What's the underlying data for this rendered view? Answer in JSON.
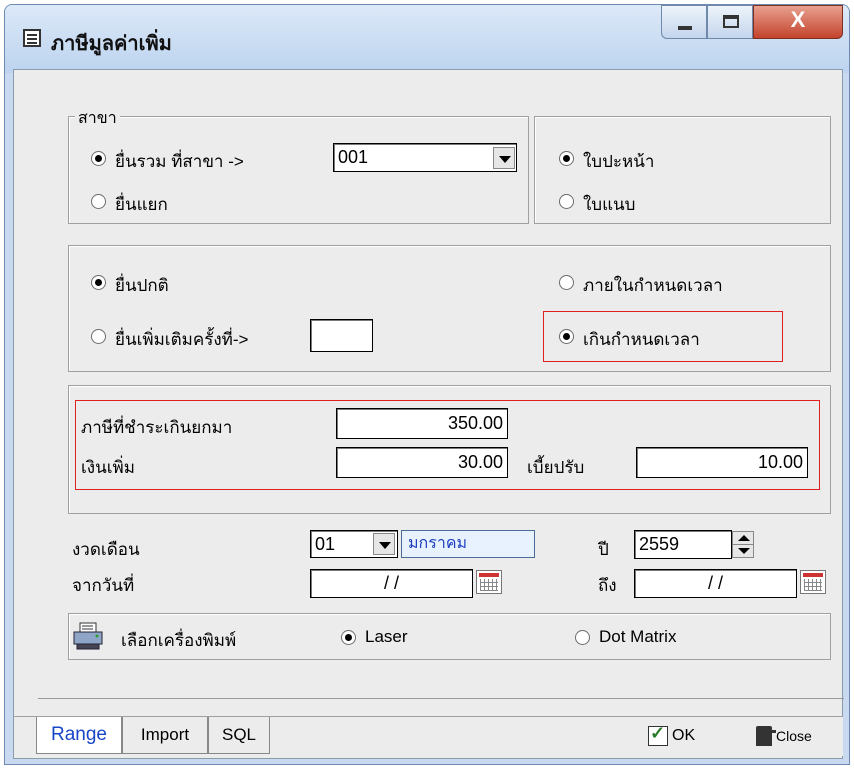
{
  "window": {
    "title": "ภาษีมูลค่าเพิ่ม",
    "close_glyph": "X"
  },
  "branch_group": {
    "legend": "สาขา",
    "option_combined": "ยื่นรวม ที่สาขา ->",
    "option_separate": "ยื่นแยก",
    "branch_value": "001",
    "selected": "combined"
  },
  "sheet_group": {
    "option_cover": "ใบปะหน้า",
    "option_attach": "ใบแนบ",
    "selected": "cover"
  },
  "filing_group": {
    "option_normal": "ยื่นปกติ",
    "option_additional": "ยื่นเพิ่มเติมครั้งที่->",
    "additional_value": "",
    "option_within": "ภายในกำหนดเวลา",
    "option_overdue": "เกินกำหนดเวลา",
    "selected_type": "normal",
    "selected_time": "overdue"
  },
  "amounts": {
    "tax_carried_label": "ภาษีที่ชำระเกินยกมา",
    "tax_carried_value": "350.00",
    "surcharge_label": "เงินเพิ่ม",
    "surcharge_value": "30.00",
    "penalty_label": "เบี้ยปรับ",
    "penalty_value": "10.00"
  },
  "period": {
    "month_label": "งวดเดือน",
    "month_value": "01",
    "month_name": "มกราคม",
    "year_label": "ปี",
    "year_value": "2559",
    "from_label": "จากวันที่",
    "from_value": "/ /",
    "to_label": "ถึง",
    "to_value": "/ /"
  },
  "printer": {
    "label": "เลือกเครื่องพิมพ์",
    "option_laser": "Laser",
    "option_dot": "Dot Matrix",
    "selected": "laser"
  },
  "tabs": [
    {
      "label": "Range",
      "active": true
    },
    {
      "label": "Import",
      "active": false
    },
    {
      "label": "SQL",
      "active": false
    }
  ],
  "footer": {
    "ok_label": "OK",
    "close_label": "Close"
  },
  "colors": {
    "accent_red": "#e02020",
    "active_tab_text": "#1846c8",
    "month_name_text": "#1f3fc0"
  },
  "icons": [
    "calendar-icon",
    "printer-icon",
    "check-icon",
    "door-exit-icon"
  ]
}
